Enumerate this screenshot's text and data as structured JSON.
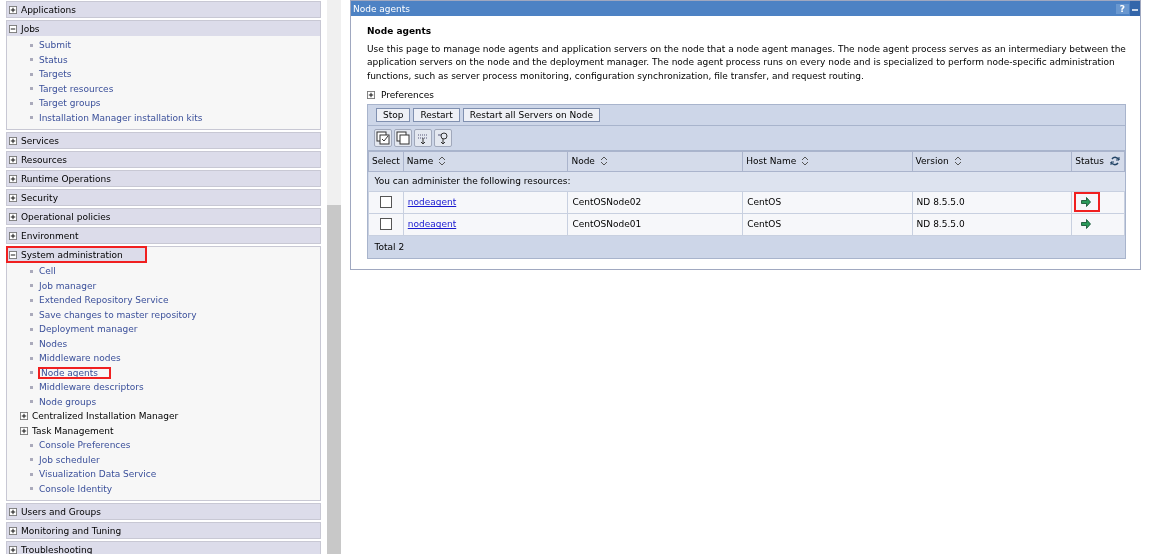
{
  "sidebar": {
    "sections": [
      {
        "label": "Applications",
        "expanded": false,
        "highlighted": false
      },
      {
        "label": "Jobs",
        "expanded": true,
        "highlighted": false,
        "items": [
          {
            "kind": "link",
            "label": "Submit",
            "highlighted": false
          },
          {
            "kind": "link",
            "label": "Status",
            "highlighted": false
          },
          {
            "kind": "link",
            "label": "Targets",
            "highlighted": false
          },
          {
            "kind": "link",
            "label": "Target resources",
            "highlighted": false
          },
          {
            "kind": "link",
            "label": "Target groups",
            "highlighted": false
          },
          {
            "kind": "link",
            "label": "Installation Manager installation kits",
            "highlighted": false
          }
        ]
      },
      {
        "label": "Services",
        "expanded": false,
        "highlighted": false
      },
      {
        "label": "Resources",
        "expanded": false,
        "highlighted": false
      },
      {
        "label": "Runtime Operations",
        "expanded": false,
        "highlighted": false
      },
      {
        "label": "Security",
        "expanded": false,
        "highlighted": false
      },
      {
        "label": "Operational policies",
        "expanded": false,
        "highlighted": false
      },
      {
        "label": "Environment",
        "expanded": false,
        "highlighted": false
      },
      {
        "label": "System administration",
        "expanded": true,
        "highlighted": true,
        "items": [
          {
            "kind": "link",
            "label": "Cell",
            "highlighted": false
          },
          {
            "kind": "link",
            "label": "Job manager",
            "highlighted": false
          },
          {
            "kind": "link",
            "label": "Extended Repository Service",
            "highlighted": false
          },
          {
            "kind": "link",
            "label": "Save changes to master repository",
            "highlighted": false
          },
          {
            "kind": "link",
            "label": "Deployment manager",
            "highlighted": false
          },
          {
            "kind": "link",
            "label": "Nodes",
            "highlighted": false
          },
          {
            "kind": "link",
            "label": "Middleware nodes",
            "highlighted": false
          },
          {
            "kind": "link",
            "label": "Node agents",
            "highlighted": true
          },
          {
            "kind": "link",
            "label": "Middleware descriptors",
            "highlighted": false
          },
          {
            "kind": "link",
            "label": "Node groups",
            "highlighted": false
          },
          {
            "kind": "group",
            "label": "Centralized Installation Manager",
            "highlighted": false
          },
          {
            "kind": "group",
            "label": "Task Management",
            "highlighted": false
          },
          {
            "kind": "link",
            "label": "Console Preferences",
            "highlighted": false
          },
          {
            "kind": "link",
            "label": "Job scheduler",
            "highlighted": false
          },
          {
            "kind": "link",
            "label": "Visualization Data Service",
            "highlighted": false
          },
          {
            "kind": "link",
            "label": "Console Identity",
            "highlighted": false
          }
        ]
      },
      {
        "label": "Users and Groups",
        "expanded": false,
        "highlighted": false
      },
      {
        "label": "Monitoring and Tuning",
        "expanded": false,
        "highlighted": false
      },
      {
        "label": "Troubleshooting",
        "expanded": false,
        "highlighted": false
      }
    ]
  },
  "panel": {
    "title": "Node agents",
    "help": "?",
    "heading": "Node agents",
    "description": "Use this page to manage node agents and application servers on the node that a node agent manages. The node agent process serves as an intermediary between the application servers on the node and the deployment manager. The node agent process runs on every node and is specialized to perform node-specific administration functions, such as server process monitoring, configuration synchronization, file transfer, and request routing.",
    "preferences": {
      "label": "Preferences",
      "expanded": false
    },
    "buttons": [
      "Stop",
      "Restart",
      "Restart all Servers on Node"
    ],
    "table": {
      "columns": [
        {
          "label": "Select",
          "sortable": false
        },
        {
          "label": "Name",
          "sortable": true
        },
        {
          "label": "Node",
          "sortable": true
        },
        {
          "label": "Host Name",
          "sortable": true
        },
        {
          "label": "Version",
          "sortable": true
        },
        {
          "label": "Status",
          "sortable": false
        }
      ],
      "group_label": "You can administer the following resources:",
      "rows": [
        {
          "checked": false,
          "name": "nodeagent",
          "node": "CentOSNode02",
          "host": "CentOS",
          "version": "ND 8.5.5.0",
          "kind": "running",
          "highlighted": true
        },
        {
          "checked": false,
          "name": "nodeagent",
          "node": "CentOSNode01",
          "host": "CentOS",
          "version": "ND 8.5.5.0",
          "kind": "running",
          "highlighted": false
        }
      ],
      "total": "Total 2"
    }
  }
}
